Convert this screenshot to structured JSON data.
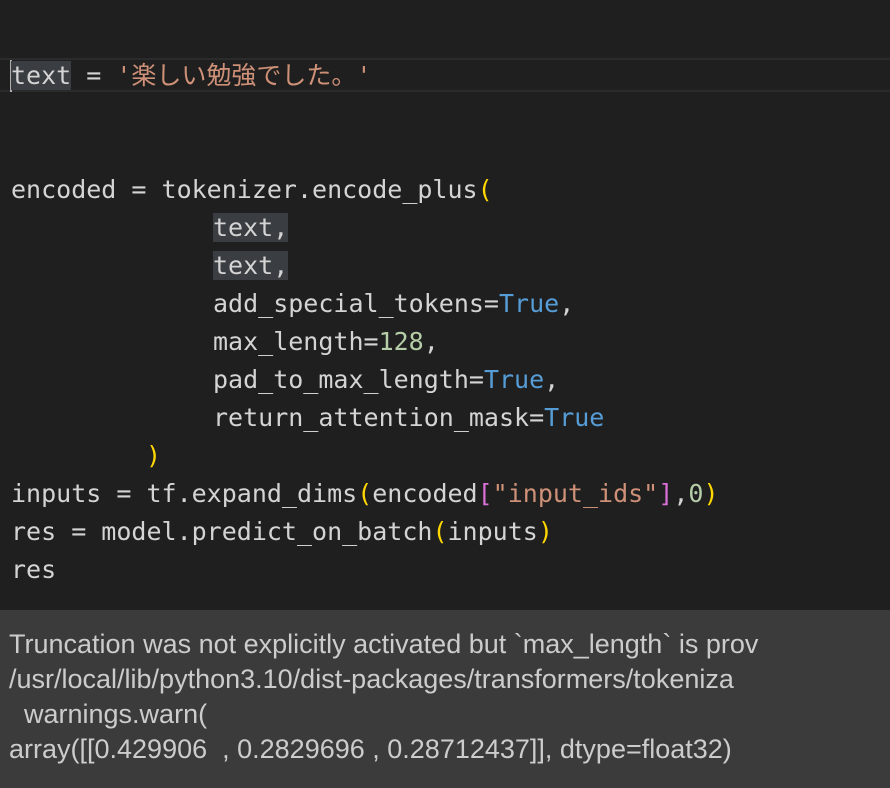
{
  "code": {
    "line1": {
      "var": "text",
      "op": " = ",
      "str": "'楽しい勉強でした。'"
    },
    "line2": {
      "lhs": "encoded = tokenizer.encode_plus",
      "open": "("
    },
    "line3": {
      "text": "text,"
    },
    "line4": {
      "text": "text,"
    },
    "line5": {
      "name": "add_special_tokens=",
      "val": "True",
      "tail": ","
    },
    "line6": {
      "name": "max_length=",
      "val": "128",
      "tail": ","
    },
    "line7": {
      "name": "pad_to_max_length=",
      "val": "True",
      "tail": ","
    },
    "line8": {
      "name": "return_attention_mask=",
      "val": "True"
    },
    "line9": {
      "close": ")"
    },
    "line10": {
      "a": "inputs = tf.expand_dims",
      "p1": "(",
      "b": "encoded",
      "p2": "[",
      "s": "\"input_ids\"",
      "p3": "]",
      "c": ",",
      "n": "0",
      "p4": ")"
    },
    "line11": {
      "a": "res = model.predict_on_batch",
      "p1": "(",
      "b": "inputs",
      "p2": ")"
    },
    "line12": {
      "text": "res"
    }
  },
  "output": {
    "lines": [
      "Truncation was not explicitly activated but `max_length` is prov",
      "/usr/local/lib/python3.10/dist-packages/transformers/tokeniza",
      "  warnings.warn(",
      "array([[0.429906  , 0.2829696 , 0.28712437]], dtype=float32)"
    ]
  },
  "colors": {
    "background": "#1f1f1f",
    "string": "#ce9178",
    "keyword": "#569cd6",
    "number": "#b5cea8",
    "bracket_gold": "#ffd700",
    "bracket_purple": "#da70d6",
    "output_background": "#3b3b3b"
  }
}
